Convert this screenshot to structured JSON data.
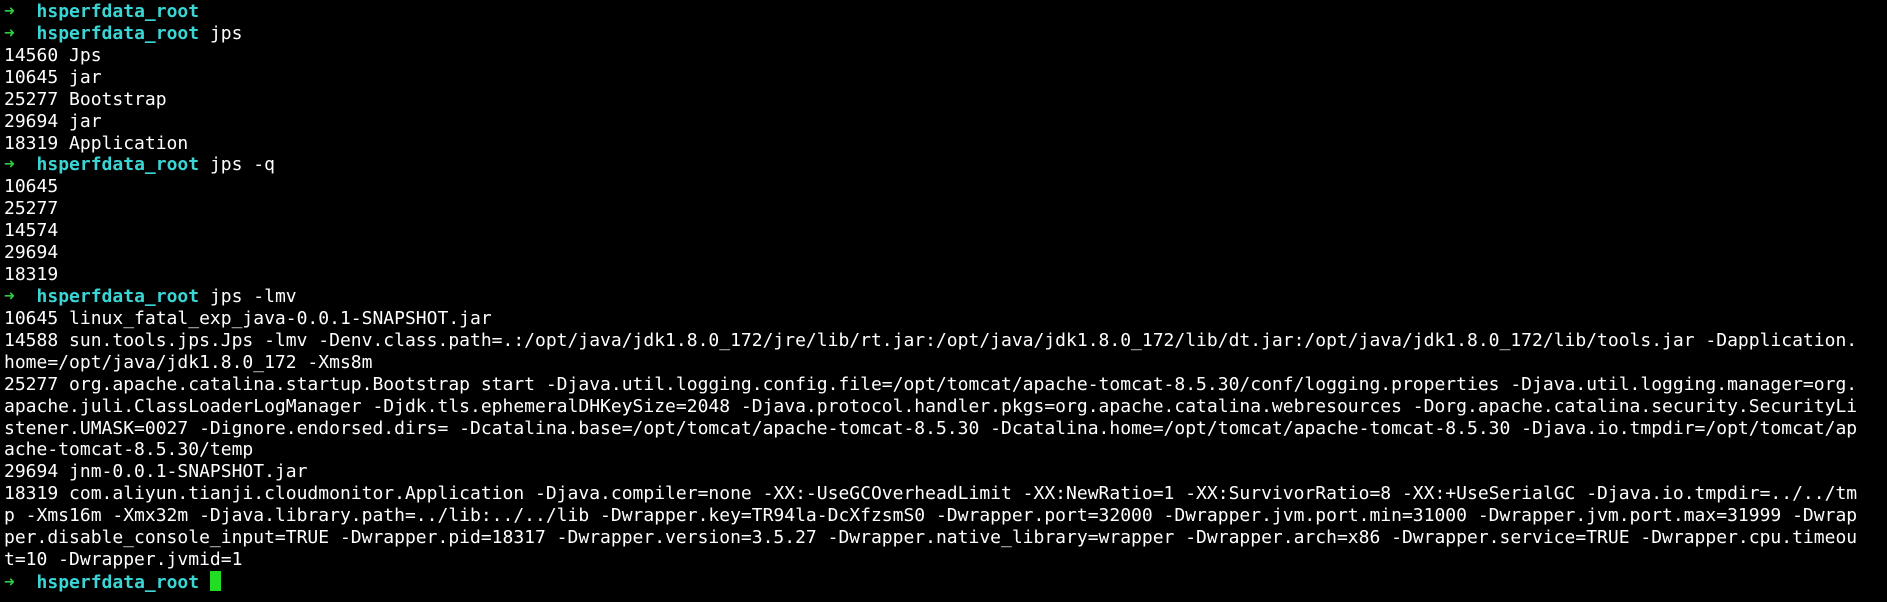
{
  "colors": {
    "background": "#000000",
    "text": "#ffffff",
    "prompt_arrow": "#2ecc40",
    "prompt_dir": "#3ad6d6",
    "cursor": "#22dd22"
  },
  "prompt": {
    "arrow": "➜",
    "dir": "hsperfdata_root"
  },
  "lines": [
    {
      "type": "prompt",
      "cmd": ""
    },
    {
      "type": "prompt",
      "cmd": "jps"
    },
    {
      "type": "output",
      "text": "14560 Jps"
    },
    {
      "type": "output",
      "text": "10645 jar"
    },
    {
      "type": "output",
      "text": "25277 Bootstrap"
    },
    {
      "type": "output",
      "text": "29694 jar"
    },
    {
      "type": "output",
      "text": "18319 Application"
    },
    {
      "type": "prompt",
      "cmd": "jps -q"
    },
    {
      "type": "output",
      "text": "10645"
    },
    {
      "type": "output",
      "text": "25277"
    },
    {
      "type": "output",
      "text": "14574"
    },
    {
      "type": "output",
      "text": "29694"
    },
    {
      "type": "output",
      "text": "18319"
    },
    {
      "type": "prompt",
      "cmd": "jps -lmv"
    },
    {
      "type": "output",
      "text": "10645 linux_fatal_exp_java-0.0.1-SNAPSHOT.jar"
    },
    {
      "type": "output",
      "text": "14588 sun.tools.jps.Jps -lmv -Denv.class.path=.:/opt/java/jdk1.8.0_172/jre/lib/rt.jar:/opt/java/jdk1.8.0_172/lib/dt.jar:/opt/java/jdk1.8.0_172/lib/tools.jar -Dapplication."
    },
    {
      "type": "output",
      "text": "home=/opt/java/jdk1.8.0_172 -Xms8m"
    },
    {
      "type": "output",
      "text": "25277 org.apache.catalina.startup.Bootstrap start -Djava.util.logging.config.file=/opt/tomcat/apache-tomcat-8.5.30/conf/logging.properties -Djava.util.logging.manager=org."
    },
    {
      "type": "output",
      "text": "apache.juli.ClassLoaderLogManager -Djdk.tls.ephemeralDHKeySize=2048 -Djava.protocol.handler.pkgs=org.apache.catalina.webresources -Dorg.apache.catalina.security.SecurityLi"
    },
    {
      "type": "output",
      "text": "stener.UMASK=0027 -Dignore.endorsed.dirs= -Dcatalina.base=/opt/tomcat/apache-tomcat-8.5.30 -Dcatalina.home=/opt/tomcat/apache-tomcat-8.5.30 -Djava.io.tmpdir=/opt/tomcat/ap"
    },
    {
      "type": "output",
      "text": "ache-tomcat-8.5.30/temp"
    },
    {
      "type": "output",
      "text": "29694 jnm-0.0.1-SNAPSHOT.jar"
    },
    {
      "type": "output",
      "text": "18319 com.aliyun.tianji.cloudmonitor.Application -Djava.compiler=none -XX:-UseGCOverheadLimit -XX:NewRatio=1 -XX:SurvivorRatio=8 -XX:+UseSerialGC -Djava.io.tmpdir=../../tm"
    },
    {
      "type": "output",
      "text": "p -Xms16m -Xmx32m -Djava.library.path=../lib:../../lib -Dwrapper.key=TR94la-DcXfzsmS0 -Dwrapper.port=32000 -Dwrapper.jvm.port.min=31000 -Dwrapper.jvm.port.max=31999 -Dwrap"
    },
    {
      "type": "output",
      "text": "per.disable_console_input=TRUE -Dwrapper.pid=18317 -Dwrapper.version=3.5.27 -Dwrapper.native_library=wrapper -Dwrapper.arch=x86 -Dwrapper.service=TRUE -Dwrapper.cpu.timeou"
    },
    {
      "type": "output",
      "text": "t=10 -Dwrapper.jvmid=1"
    },
    {
      "type": "prompt",
      "cmd": "",
      "cursor": true
    }
  ]
}
